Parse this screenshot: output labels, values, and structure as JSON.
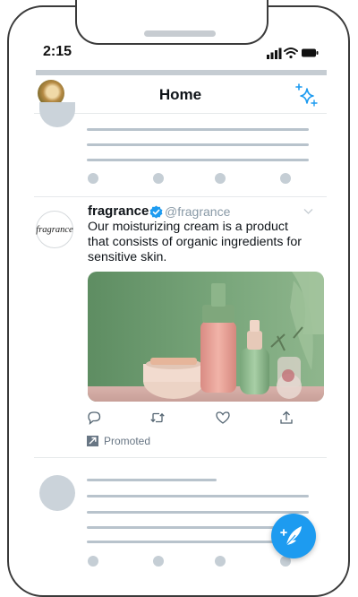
{
  "status_bar": {
    "time": "2:15"
  },
  "header": {
    "title": "Home"
  },
  "tweet": {
    "author_name": "fragrance",
    "handle": "@fragrance",
    "avatar_logo_text": "fragrance",
    "text": "Our moisturizing cream is a product that consists of organic ingredients for sensitive skin.",
    "promoted_label": "Promoted"
  },
  "icons": {
    "signal": "signal-icon",
    "wifi": "wifi-icon",
    "battery": "battery-icon",
    "sparkle": "sparkle-icon",
    "verified": "verified-badge-icon",
    "more": "chevron-down-icon",
    "reply": "reply-icon",
    "retweet": "retweet-icon",
    "like": "heart-icon",
    "share": "share-icon",
    "promoted": "promoted-icon",
    "compose": "compose-tweet-icon"
  },
  "colors": {
    "accent": "#1d9bf0",
    "verified": "#1d9bf0",
    "placeholder": "#c5ced5"
  }
}
